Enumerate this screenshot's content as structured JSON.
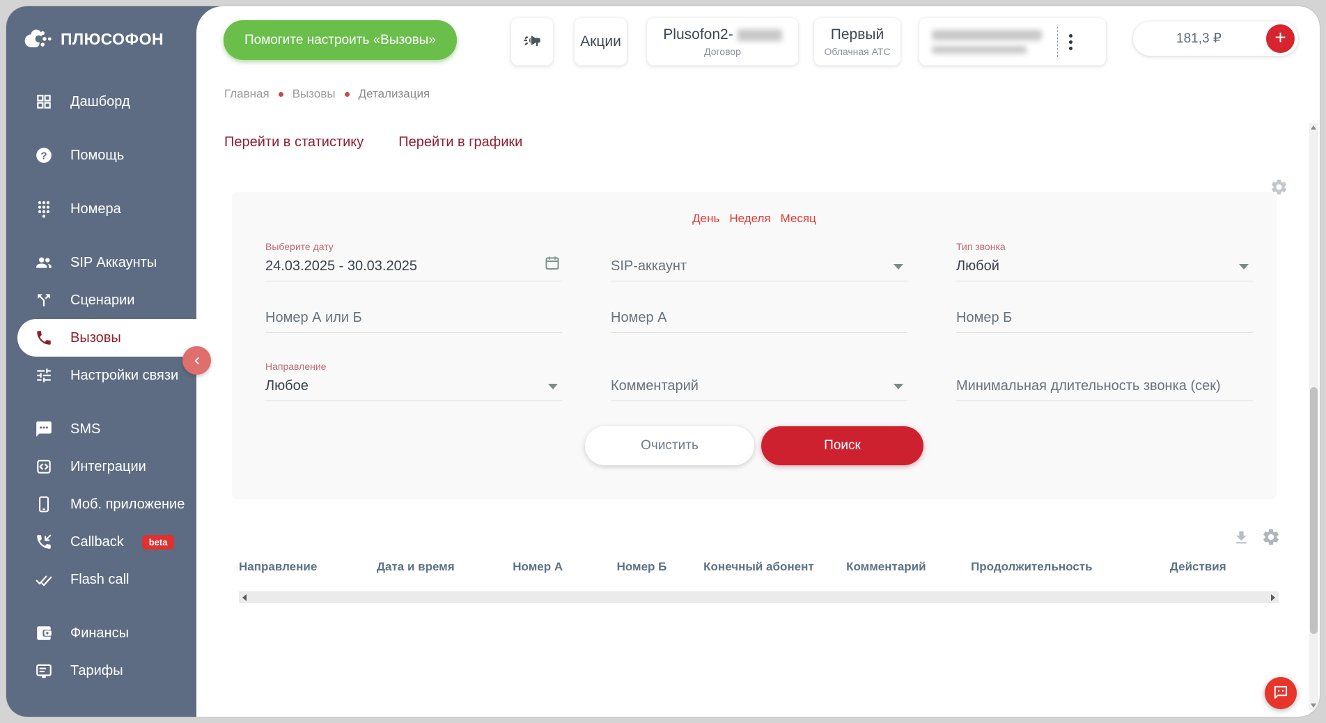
{
  "colors": {
    "sidebar_bg": "#5e6c83",
    "accent_red": "#ce2130",
    "link_maroon": "#8e1f31",
    "toggle_red": "#e53935",
    "green_button": "#6abe4a",
    "collapse_salmon": "#df6f6d",
    "beta_badge": "#e03131"
  },
  "sidebar": {
    "logo_text": "ПЛЮСОФОН",
    "items": [
      {
        "label": "Дашборд",
        "icon": "dashboard-icon"
      },
      {
        "label": "Помощь",
        "icon": "help-icon"
      },
      {
        "label": "Номера",
        "icon": "dialpad-icon"
      },
      {
        "label": "SIP Аккаунты",
        "icon": "people-icon"
      },
      {
        "label": "Сценарии",
        "icon": "call-split-icon"
      },
      {
        "label": "Вызовы",
        "icon": "phone-icon",
        "active": true
      },
      {
        "label": "Настройки связи",
        "icon": "tune-icon"
      },
      {
        "label": "SMS",
        "icon": "sms-icon"
      },
      {
        "label": "Интеграции",
        "icon": "integrations-icon"
      },
      {
        "label": "Моб. приложение",
        "icon": "smartphone-icon"
      },
      {
        "label": "Callback",
        "icon": "callback-icon",
        "badge": "beta"
      },
      {
        "label": "Flash call",
        "icon": "flash-call-icon"
      },
      {
        "label": "Финансы",
        "icon": "wallet-icon"
      },
      {
        "label": "Тарифы",
        "icon": "tariffs-icon"
      }
    ]
  },
  "header": {
    "help_button": "Помогите настроить «Вызовы»",
    "promo_card": "Акции",
    "account_card": {
      "title_visible": "Plusofon2-",
      "subtitle": "Договор"
    },
    "pbx_card": {
      "title": "Первый",
      "subtitle": "Облачная АТС"
    },
    "balance": {
      "amount": "181,3 ₽",
      "add_label": "+"
    }
  },
  "breadcrumb": {
    "items": [
      "Главная",
      "Вызовы",
      "Детализация"
    ]
  },
  "nav_links": {
    "statistics": "Перейти в статистику",
    "charts": "Перейти в графики"
  },
  "filters": {
    "period_tabs": [
      "День",
      "Неделя",
      "Месяц"
    ],
    "date": {
      "label": "Выберите дату",
      "value": "24.03.2025 - 30.03.2025"
    },
    "sip_account": {
      "placeholder": "SIP-аккаунт"
    },
    "call_type": {
      "label": "Тип звонка",
      "value": "Любой"
    },
    "number_a_or_b": {
      "placeholder": "Номер А или Б"
    },
    "number_a": {
      "placeholder": "Номер А"
    },
    "number_b": {
      "placeholder": "Номер Б"
    },
    "direction": {
      "label": "Направление",
      "value": "Любое"
    },
    "comment": {
      "placeholder": "Комментарий"
    },
    "min_duration": {
      "placeholder": "Минимальная длительность звонка (сек)"
    },
    "clear_button": "Очистить",
    "search_button": "Поиск"
  },
  "table": {
    "headers": [
      "Направление",
      "Дата и время",
      "Номер А",
      "Номер Б",
      "Конечный абонент",
      "Комментарий",
      "Продолжительность",
      "Действия"
    ]
  }
}
